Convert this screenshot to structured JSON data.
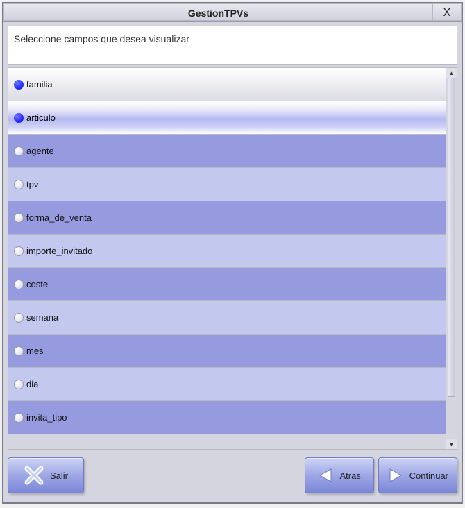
{
  "window": {
    "title": "GestionTPVs",
    "close_label": "X"
  },
  "instruction": "Seleccione campos que desea visualizar",
  "fields": [
    {
      "name": "familia",
      "selected": true
    },
    {
      "name": "articulo",
      "selected": true
    },
    {
      "name": "agente",
      "selected": false
    },
    {
      "name": "tpv",
      "selected": false
    },
    {
      "name": "forma_de_venta",
      "selected": false
    },
    {
      "name": "importe_invitado",
      "selected": false
    },
    {
      "name": "coste",
      "selected": false
    },
    {
      "name": "semana",
      "selected": false
    },
    {
      "name": "mes",
      "selected": false
    },
    {
      "name": "dia",
      "selected": false
    },
    {
      "name": "invita_tipo",
      "selected": false
    }
  ],
  "footer": {
    "exit_label": "Salir",
    "back_label": "Atras",
    "continue_label": "Continuar"
  }
}
